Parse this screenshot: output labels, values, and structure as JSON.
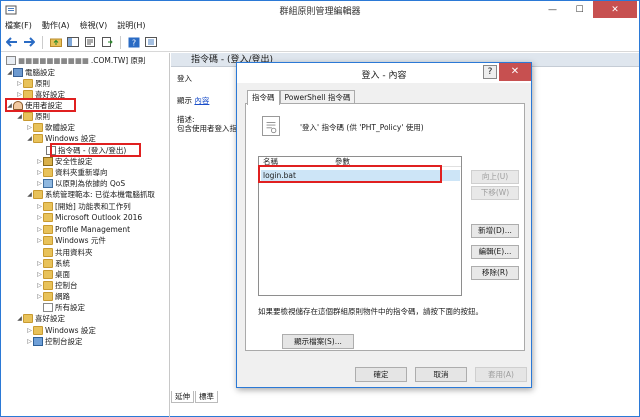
{
  "window": {
    "title": "群組原則管理編輯器",
    "min": "—",
    "max": "☐",
    "close": "✕"
  },
  "menu": [
    "檔案(F)",
    "動作(A)",
    "檢視(V)",
    "說明(H)"
  ],
  "tree": {
    "root": ".COM.TW] 原則",
    "computer_config": "電腦設定",
    "cc_policy": "原則",
    "cc_prefs": "喜好設定",
    "user_config": "使用者設定",
    "uc_policy": "原則",
    "software": "軟體設定",
    "windows_settings": "Windows 設定",
    "scripts": "指令碼 - (登入/登出)",
    "security": "安全性設定",
    "folder_redirect": "資料夾重新導向",
    "qos": "以原則為依據的 QoS",
    "ie_maintenance": "系統管理範本: 已從本機電腦抓取",
    "start_menu": "[開始] 功能表和工作列",
    "outlook": "Microsoft Outlook 2016",
    "profile_mgmt": "Profile Management",
    "windows_components": "Windows 元件",
    "shared_folders": "共用資料夾",
    "system": "系統",
    "desktop": "桌面",
    "control_panel": "控制台",
    "network": "網路",
    "all_settings": "所有設定",
    "uc_prefs": "喜好設定",
    "p_windows": "Windows 設定",
    "p_control": "控制台設定"
  },
  "right": {
    "header": "指令碼 - (登入/登出)",
    "item": "登入",
    "display_label": "顯示",
    "display_link": "內容",
    "desc_label": "描述:",
    "desc_text": "包含使用者登入指"
  },
  "bottom_tabs": [
    "延伸",
    "標準"
  ],
  "dialog": {
    "title": "登入 - 內容",
    "help": "?",
    "close": "✕",
    "tabs": [
      "指令碼",
      "PowerShell 指令碼"
    ],
    "intro": "'登入' 指令碼 (供 'PHT_Policy' 使用)",
    "col_name": "名稱",
    "col_params": "參數",
    "rows": [
      "login.bat"
    ],
    "btn_up": "向上(U)",
    "btn_down": "下移(W)",
    "btn_add": "新增(D)...",
    "btn_edit": "編輯(E)...",
    "btn_remove": "移除(R)",
    "note": "如果要檢視儲存在這個群組原則物件中的指令碼，請按下面的按鈕。",
    "show_files": "顯示檔案(S)...",
    "ok": "確定",
    "cancel": "取消",
    "apply": "套用(A)"
  },
  "colors": {
    "highlight_red": "#e02020",
    "selection": "#cde5f7",
    "titlebar_close": "#c75050"
  }
}
